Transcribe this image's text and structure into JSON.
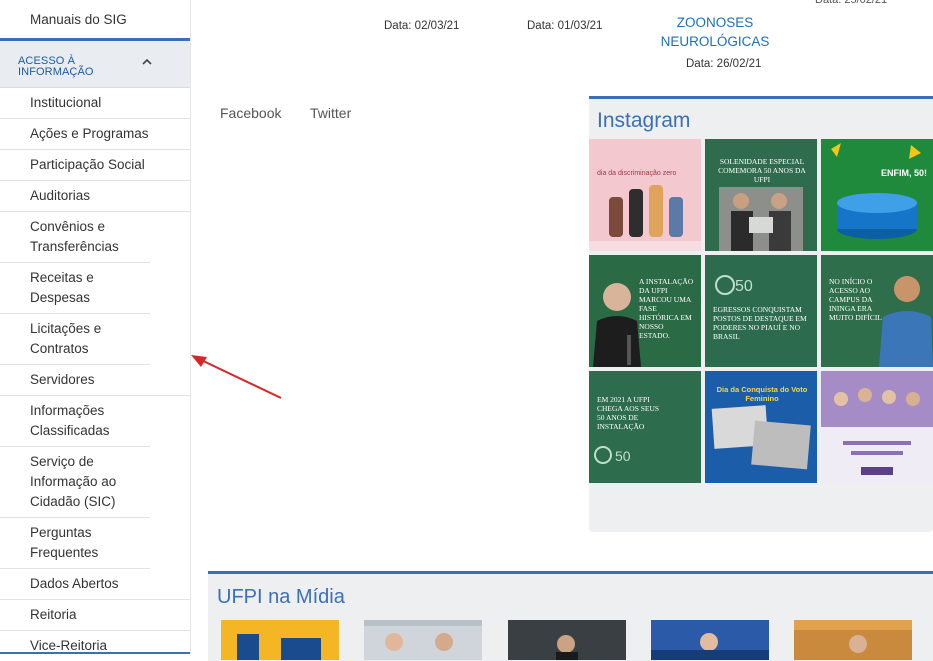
{
  "sidebar": {
    "top_item": "Manuais do SIG",
    "section_header": "ACESSO À INFORMAÇÃO",
    "items": [
      {
        "label": "Institucional"
      },
      {
        "label": "Ações e Programas"
      },
      {
        "label": "Participação Social"
      },
      {
        "label": "Auditorias"
      },
      {
        "label": "Convênios e Transferências"
      },
      {
        "label": "Receitas e Despesas"
      },
      {
        "label": "Licitações e Contratos"
      },
      {
        "label": "Servidores"
      },
      {
        "label": "Informações Classificadas"
      },
      {
        "label": "Serviço de Informação ao Cidadão (SIC)"
      },
      {
        "label": "Perguntas Frequentes"
      },
      {
        "label": "Dados Abertos"
      },
      {
        "label": "Reitoria"
      },
      {
        "label": "Vice-Reitoria"
      }
    ]
  },
  "news": {
    "items": [
      {
        "date": "Data: 02/03/21"
      },
      {
        "date": "Data: 01/03/21"
      },
      {
        "title": "ZOONOSES NEUROLÓGICAS",
        "date": "Data: 26/02/21"
      }
    ]
  },
  "social": {
    "facebook": "Facebook",
    "twitter": "Twitter"
  },
  "instagram": {
    "title": "Instagram",
    "tiles": [
      {
        "caption": "dia da discriminação zero"
      },
      {
        "caption": "Solenidade especial comemora 50 anos da UFPI"
      },
      {
        "caption": "ENFIM, 50!"
      },
      {
        "caption": "A instalação da UFPI marcou uma fase histórica em nosso estado."
      },
      {
        "caption": "Egressos conquistam postos de destaque em poderes no Piauí e no Brasil"
      },
      {
        "caption": "No início o acesso ao campus da Ininga era muito difícil"
      },
      {
        "caption": "Em 2021 a UFPI chega aos seus 50 anos de instalação"
      },
      {
        "caption": "Dia da Conquista do Voto Feminino"
      },
      {
        "caption": ""
      }
    ]
  },
  "midia": {
    "title": "UFPI na Mídia"
  },
  "colors": {
    "accent": "#3b6fb6",
    "link": "#1e6fb8",
    "card_bg": "#eeeff1",
    "arrow": "#d62728"
  }
}
